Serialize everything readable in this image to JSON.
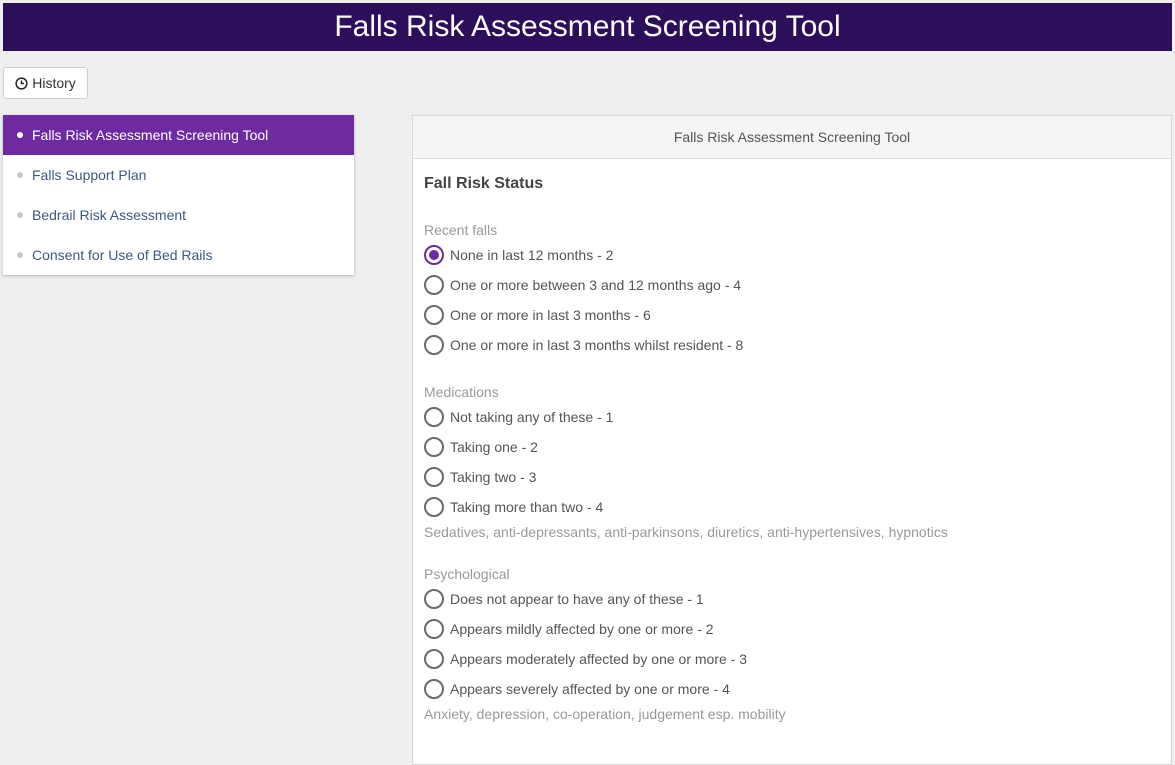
{
  "header": {
    "title": "Falls Risk Assessment Screening Tool"
  },
  "toolbar": {
    "history_label": "History"
  },
  "sidebar": {
    "items": [
      {
        "label": "Falls Risk Assessment Screening Tool",
        "active": true
      },
      {
        "label": "Falls Support Plan",
        "active": false
      },
      {
        "label": "Bedrail Risk Assessment",
        "active": false
      },
      {
        "label": "Consent for Use of Bed Rails",
        "active": false
      }
    ]
  },
  "panel": {
    "title": "Falls Risk Assessment Screening Tool",
    "section_title": "Fall Risk Status",
    "groups": [
      {
        "label": "Recent falls",
        "options": [
          "None in last 12 months - 2",
          "One or more between 3 and 12 months ago - 4",
          "One or more in last 3 months - 6",
          "One or more in last 3 months whilst resident - 8"
        ],
        "selected_index": 0,
        "hint": ""
      },
      {
        "label": "Medications",
        "options": [
          "Not taking any of these - 1",
          "Taking one - 2",
          "Taking two - 3",
          "Taking more than two - 4"
        ],
        "selected_index": -1,
        "hint": "Sedatives, anti-depressants, anti-parkinsons, diuretics, anti-hypertensives, hypnotics"
      },
      {
        "label": "Psychological",
        "options": [
          "Does not appear to have any of these - 1",
          "Appears mildly affected by one or more - 2",
          "Appears moderately affected by one or more - 3",
          "Appears severely affected by one or more - 4"
        ],
        "selected_index": -1,
        "hint": "Anxiety, depression, co-operation, judgement esp. mobility"
      }
    ]
  },
  "colors": {
    "header_bg": "#2d0e5a",
    "accent": "#6e2aa0",
    "link": "#3b5a80"
  },
  "icons": {
    "history": "clock-icon"
  }
}
